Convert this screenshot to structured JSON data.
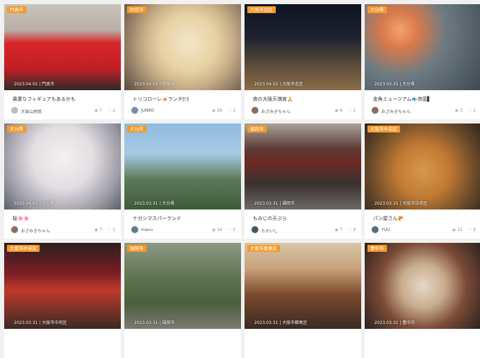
{
  "cards": [
    {
      "area": "門真市",
      "date": "2023.04.02 | 門真市",
      "title": "貴重なフィギュアもあるかも",
      "author": "大宙山地翁",
      "views": "7",
      "likes": "2",
      "bg": "linear-gradient(180deg,#c9c3bd 0%,#b8b0a5 30%,#d6262a 45%,#c21f24 75%,#2e2a28 100%)",
      "avatar": "#bdbdbd"
    },
    {
      "area": "吹田市",
      "date": "2023.04.02 | 吹田市",
      "title": "トリコローレ🍝ランチ🍽",
      "author": "JUNKO",
      "views": "29",
      "likes": "1",
      "bg": "radial-gradient(circle at 55% 45%,#f2e5c9 0%,#e8d2a4 35%,#c9b08a 55%,#5a4a3e 100%)",
      "avatar": "#7b8da3"
    },
    {
      "area": "大阪市北区",
      "date": "2023.04.02 | 大阪市北区",
      "title": "夜の大阪天満宮🙏",
      "author": "おざみきちゃん",
      "views": "6",
      "likes": "1",
      "bg": "linear-gradient(180deg,#0d1320 0%,#1f2430 40%,#5a4b3a 70%,#8b6d4a 100%)",
      "avatar": "#8d6e63"
    },
    {
      "area": "大分県",
      "date": "2023.03.31 | 大分県",
      "title": "金魚ミュージアム🐟帝国▌",
      "author": "おざみきちゃん",
      "views": "3",
      "likes": "1",
      "bg": "radial-gradient(circle at 30% 30%,#f4a36a 0%,#d97a4a 18%,#6f7b82 45%,#3d4950 100%)",
      "avatar": "#8d6e63"
    },
    {
      "area": "大分県",
      "date": "2023.04.02 | 大分県",
      "title": "桜🌸🌸",
      "author": "おざみきちゃん",
      "views": "7",
      "likes": "1",
      "bg": "radial-gradient(circle at 50% 40%,#f4f1f2 0%,#e3dde1 40%,#9a9aa5 75%,#5a5d66 100%)",
      "avatar": "#8d6e63"
    },
    {
      "area": "大分県",
      "date": "2023.03.31 | 大分県",
      "title": "ナガシマスパーランド",
      "author": "mavu",
      "views": "14",
      "likes": "2",
      "bg": "linear-gradient(180deg,#8fbce0 0%,#a7c9e3 35%,#5c7a5a 65%,#3f5a3b 100%)",
      "avatar": "#607d8b"
    },
    {
      "area": "福岡市",
      "date": "2023.03.31 | 福岡市",
      "title": "もみじの天ぷら",
      "author": "たかいし",
      "views": "7",
      "likes": "3",
      "bg": "linear-gradient(180deg,#a8a29a 0%,#5d3a34 30%,#6d2a26 45%,#3a3230 70%,#6e6a66 100%)",
      "avatar": "#455a64"
    },
    {
      "area": "大阪市中央区",
      "date": "2023.03.31 | 大阪市中央区",
      "title": "パン屋さん🥐",
      "author": "YUU",
      "views": "12",
      "likes": "2",
      "bg": "radial-gradient(circle at 50% 55%,#d59a4c 0%,#c17a33 35%,#6b4a2a 70%,#2e241d 100%)",
      "avatar": "#546e7a"
    },
    {
      "area": "大阪市中央区",
      "date": "2023.03.31 | 大阪市中央区",
      "title": "",
      "author": "",
      "views": "",
      "likes": "",
      "bg": "linear-gradient(180deg,#2b1f1f 0%,#7a1e24 35%,#c0392b 55%,#3a2a22 100%)",
      "avatar": "#cccccc"
    },
    {
      "area": "福岡市",
      "date": "2023.03.31 | 福岡市",
      "title": "",
      "author": "",
      "views": "",
      "likes": "",
      "bg": "linear-gradient(180deg,#8e9884 0%,#5f7550 40%,#4a5f3c 70%,#7b7a70 100%)",
      "avatar": "#cccccc"
    },
    {
      "area": "大阪市都島区",
      "date": "2023.03.31 | 大阪市都島区",
      "title": "",
      "author": "",
      "views": "",
      "likes": "",
      "bg": "linear-gradient(180deg,#d7c5a8 0%,#c8a27a 30%,#7b4a2c 60%,#3a2a22 100%)",
      "avatar": "#cccccc"
    },
    {
      "area": "豊中市",
      "date": "2023.03.31 | 豊中市",
      "title": "",
      "author": "",
      "views": "",
      "likes": "",
      "bg": "radial-gradient(circle at 50% 50%,#e6d8c8 0%,#c9ad8e 30%,#7a4a36 60%,#2a211d 100%)",
      "avatar": "#cccccc"
    }
  ]
}
